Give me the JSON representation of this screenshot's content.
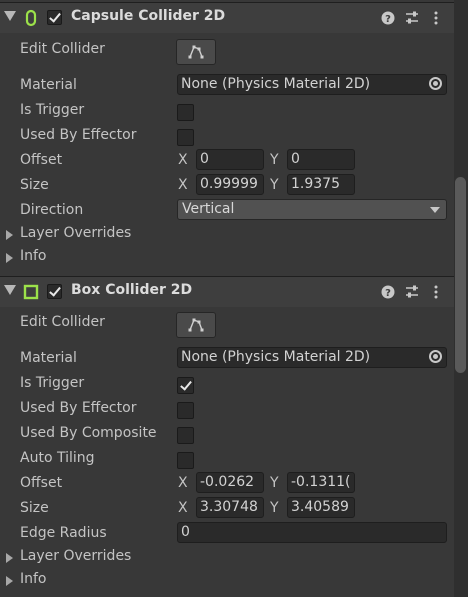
{
  "capsule": {
    "title": "Capsule Collider 2D",
    "enabled": true,
    "icon": "capsule-collider-icon",
    "edit_collider_label": "Edit Collider",
    "material_label": "Material",
    "material_value": "None (Physics Material 2D)",
    "is_trigger_label": "Is Trigger",
    "is_trigger": false,
    "used_by_effector_label": "Used By Effector",
    "used_by_effector": false,
    "offset_label": "Offset",
    "offset_x": "0",
    "offset_y": "0",
    "size_label": "Size",
    "size_x": "0.99999",
    "size_y": "1.9375",
    "direction_label": "Direction",
    "direction_value": "Vertical",
    "layer_overrides_label": "Layer Overrides",
    "info_label": "Info"
  },
  "box": {
    "title": "Box Collider 2D",
    "enabled": true,
    "icon": "box-collider-icon",
    "edit_collider_label": "Edit Collider",
    "material_label": "Material",
    "material_value": "None (Physics Material 2D)",
    "is_trigger_label": "Is Trigger",
    "is_trigger": true,
    "used_by_effector_label": "Used By Effector",
    "used_by_effector": false,
    "used_by_composite_label": "Used By Composite",
    "used_by_composite": false,
    "auto_tiling_label": "Auto Tiling",
    "auto_tiling": false,
    "offset_label": "Offset",
    "offset_x": "-0.0262",
    "offset_y": "-0.1311(",
    "size_label": "Size",
    "size_x": "3.30748",
    "size_y": "3.40589",
    "edge_radius_label": "Edge Radius",
    "edge_radius": "0",
    "layer_overrides_label": "Layer Overrides",
    "info_label": "Info"
  },
  "axes": {
    "x": "X",
    "y": "Y"
  },
  "colors": {
    "accent_green": "#9ce24a",
    "panel_bg": "#383838",
    "header_bg": "#3e3e3e",
    "field_bg": "#2a2a2a"
  }
}
